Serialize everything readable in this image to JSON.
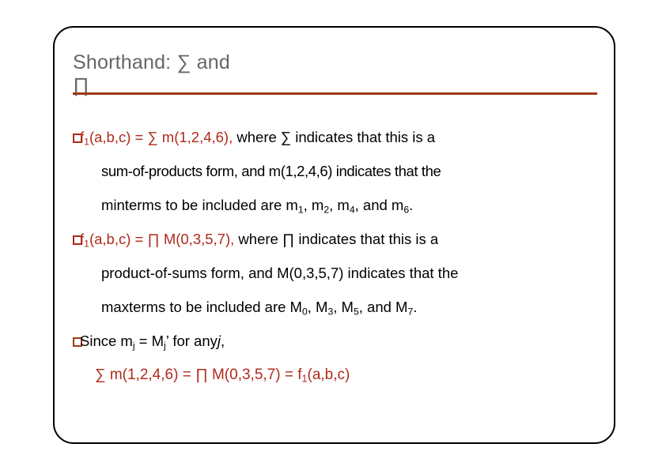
{
  "slide": {
    "title_line1": "Shorthand: ∑ and",
    "title_wrapped_glyph": "∏",
    "title_color": "#666666",
    "rule_color": "#9c3a19",
    "accent_red": "#ae2a1b",
    "frame_color": "#000000",
    "background": "#ffffff"
  },
  "bullets": [
    {
      "id": "bullet-sop",
      "marker": "missing-glyph-box",
      "marker_color": "#ae2a1b",
      "lines": [
        {
          "id": "sop-line-1",
          "red_part": "f",
          "red_sub": "1",
          "red_rest": "(a,b,c) = ∑ m(1,2,4,6),",
          "black_part": "where ∑ indicates that this is a"
        },
        {
          "id": "sop-line-2",
          "text": "sum-of-products form, and m(1,2,4,6) indicates that the"
        },
        {
          "id": "sop-line-3",
          "prefix": "minterms to be included are m",
          "sub1": "1",
          "mid1": ", m",
          "sub2": "2",
          "mid2": ", m",
          "sub3": "4",
          "mid3": ", and m",
          "sub4": "6",
          "suffix": "."
        }
      ]
    },
    {
      "id": "bullet-pos",
      "marker": "missing-glyph-box",
      "marker_color": "#ae2a1b",
      "lines": [
        {
          "id": "pos-line-1",
          "red_part": "f",
          "red_sub": "1",
          "red_rest": "(a,b,c) = ∏ M(0,3,5,7),",
          "black_part": "where ∏ indicates that this is a"
        },
        {
          "id": "pos-line-2",
          "text": "product-of-sums form, and M(0,3,5,7) indicates that the"
        },
        {
          "id": "pos-line-3",
          "prefix": "maxterms to be included are M",
          "sub1": "0",
          "mid1": ", M",
          "sub2": "3",
          "mid2": ", M",
          "sub3": "5",
          "mid3": ", and M",
          "sub4": "7",
          "suffix": "."
        }
      ]
    },
    {
      "id": "bullet-duality",
      "marker": "missing-glyph-box",
      "marker_color": "#9c3a19",
      "lines": [
        {
          "id": "duality-line-1",
          "prefix": "Since m",
          "sub1": "j",
          "mid1": " = M",
          "sub2": "j",
          "mid2": "’ for any",
          "italic": "j",
          "suffix": ","
        }
      ]
    }
  ],
  "final_equation": {
    "id": "final-equation",
    "text": "∑ m(1,2,4,6) = ∏ M(0,3,5,7) = f",
    "sub": "1",
    "tail": "(a,b,c)",
    "color": "#ae2a1b"
  }
}
